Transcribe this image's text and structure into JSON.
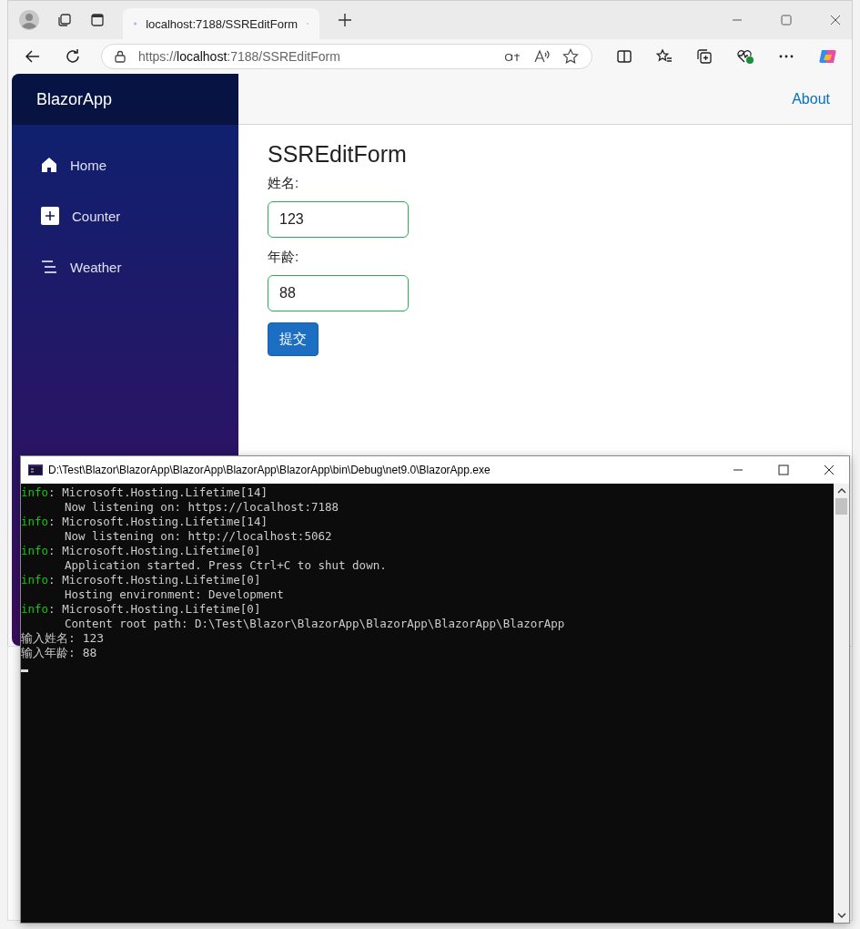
{
  "browser": {
    "tab_title": "localhost:7188/SSREditForm",
    "url_prefix": "https://",
    "url_host": "localhost",
    "url_rest": ":7188/SSREditForm"
  },
  "app": {
    "brand": "BlazorApp",
    "top_link": "About",
    "nav": [
      {
        "label": "Home",
        "kind": "home"
      },
      {
        "label": "Counter",
        "kind": "plus"
      },
      {
        "label": "Weather",
        "kind": "list"
      }
    ],
    "heading": "SSREditForm",
    "fields": [
      {
        "label": "姓名:",
        "value": "123",
        "valid": true
      },
      {
        "label": "年龄:",
        "value": "88",
        "valid": true
      }
    ],
    "submit": "提交"
  },
  "console": {
    "title": "D:\\Test\\Blazor\\BlazorApp\\BlazorApp\\BlazorApp\\BlazorApp\\bin\\Debug\\net9.0\\BlazorApp.exe",
    "lines": [
      {
        "kind": "info",
        "label": "info",
        "text": ": Microsoft.Hosting.Lifetime[14]"
      },
      {
        "kind": "detail",
        "text": "Now listening on: https://localhost:7188"
      },
      {
        "kind": "info",
        "label": "info",
        "text": ": Microsoft.Hosting.Lifetime[14]"
      },
      {
        "kind": "detail",
        "text": "Now listening on: http://localhost:5062"
      },
      {
        "kind": "info",
        "label": "info",
        "text": ": Microsoft.Hosting.Lifetime[0]"
      },
      {
        "kind": "detail",
        "text": "Application started. Press Ctrl+C to shut down."
      },
      {
        "kind": "info",
        "label": "info",
        "text": ": Microsoft.Hosting.Lifetime[0]"
      },
      {
        "kind": "detail",
        "text": "Hosting environment: Development"
      },
      {
        "kind": "info",
        "label": "info",
        "text": ": Microsoft.Hosting.Lifetime[0]"
      },
      {
        "kind": "detail",
        "text": "Content root path: D:\\Test\\Blazor\\BlazorApp\\BlazorApp\\BlazorApp\\BlazorApp"
      },
      {
        "kind": "plain",
        "text": "输入姓名: 123"
      },
      {
        "kind": "plain",
        "text": "输入年龄: 88"
      }
    ]
  }
}
